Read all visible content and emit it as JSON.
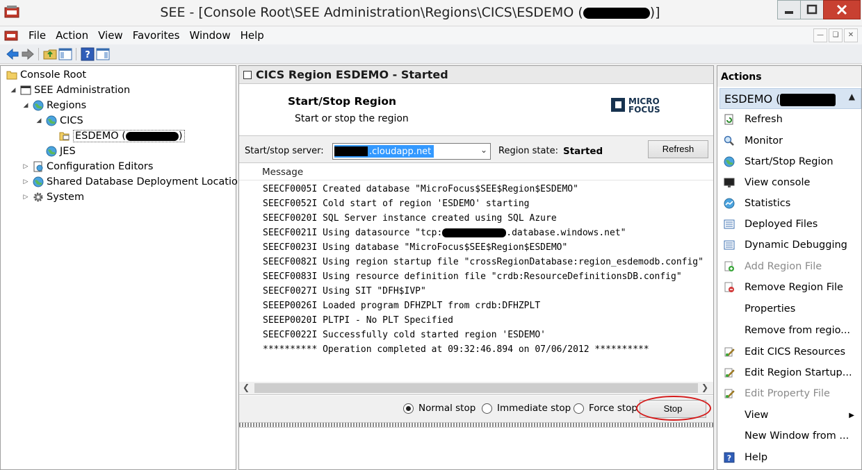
{
  "window": {
    "title": "SEE - [Console Root\\SEE Administration\\Regions\\CICS\\ESDEMO (",
    "title_end": ")]"
  },
  "menu": [
    "File",
    "Action",
    "View",
    "Favorites",
    "Window",
    "Help"
  ],
  "tree": {
    "root": "Console Root",
    "see_admin": "SEE Administration",
    "regions": "Regions",
    "cics": "CICS",
    "esdemo": "ESDEMO (",
    "esdemo_end": ")",
    "jes": "JES",
    "config_editors": "Configuration Editors",
    "shared_db": "Shared Database Deployment Locations",
    "system": "System"
  },
  "center": {
    "header_title": "CICS Region ESDEMO - Started",
    "panel_title": "Start/Stop Region",
    "panel_subtitle": "Start or stop the region",
    "logo_line1": "MICRO",
    "logo_line2": "FOCUS",
    "server_label": "Start/stop server:",
    "server_value": ".cloudapp.net",
    "region_state_label": "Region state:",
    "region_state_value": "Started",
    "refresh_label": "Refresh",
    "message_header": "Message",
    "messages": [
      "SEECF0005I Created database \"MicroFocus$SEE$Region$ESDEMO\"",
      "SEECF0052I Cold start of region 'ESDEMO' starting",
      "SEECF0020I SQL Server instance created using SQL Azure",
      "SEECF0023I Using database \"MicroFocus$SEE$Region$ESDEMO\"",
      "SEECF0082I Using region startup file \"crossRegionDatabase:region_esdemodb.config\"",
      "SEECF0083I Using resource definition file \"crdb:ResourceDefinitionsDB.config\"",
      "SEECF0027I Using SIT \"DFH$IVP\"",
      "SEEEP0026I Loaded program DFHZPLT from crdb:DFHZPLT",
      "SEEEP0020I PLTPI - No PLT Specified",
      "SEECF0022I Successfully cold started region 'ESDEMO'",
      "********** Operation completed at 09:32:46.894 on 07/06/2012 **********"
    ],
    "datasource_prefix": "SEECF0021I Using datasource \"tcp:",
    "datasource_suffix": ".database.windows.net\"",
    "radio_normal": "Normal stop",
    "radio_immediate": "Immediate stop",
    "radio_force": "Force stop",
    "stop_label": "Stop"
  },
  "actions": {
    "header": "Actions",
    "group": "ESDEMO (",
    "items": [
      {
        "label": "Refresh",
        "icon": "refresh-icon",
        "disabled": false
      },
      {
        "label": "Monitor",
        "icon": "magnifier-icon",
        "disabled": false
      },
      {
        "label": "Start/Stop Region",
        "icon": "globe-icon",
        "disabled": false
      },
      {
        "label": "View console",
        "icon": "monitor-icon",
        "disabled": false
      },
      {
        "label": "Statistics",
        "icon": "globe-stats-icon",
        "disabled": false
      },
      {
        "label": "Deployed Files",
        "icon": "list-icon",
        "disabled": false
      },
      {
        "label": "Dynamic Debugging",
        "icon": "list-icon",
        "disabled": false
      },
      {
        "label": "Add Region File",
        "icon": "add-file-icon",
        "disabled": true
      },
      {
        "label": "Remove Region File",
        "icon": "remove-file-icon",
        "disabled": false
      },
      {
        "label": "Properties",
        "icon": "",
        "disabled": false
      },
      {
        "label": "Remove from regio...",
        "icon": "",
        "disabled": false
      },
      {
        "label": "Edit CICS Resources",
        "icon": "edit-icon",
        "disabled": false
      },
      {
        "label": "Edit Region Startup...",
        "icon": "edit-icon",
        "disabled": false
      },
      {
        "label": "Edit Property File",
        "icon": "edit-icon",
        "disabled": true
      },
      {
        "label": "View",
        "icon": "",
        "disabled": false
      },
      {
        "label": "New Window from ...",
        "icon": "",
        "disabled": false
      },
      {
        "label": "Help",
        "icon": "help-icon",
        "disabled": false
      }
    ]
  }
}
